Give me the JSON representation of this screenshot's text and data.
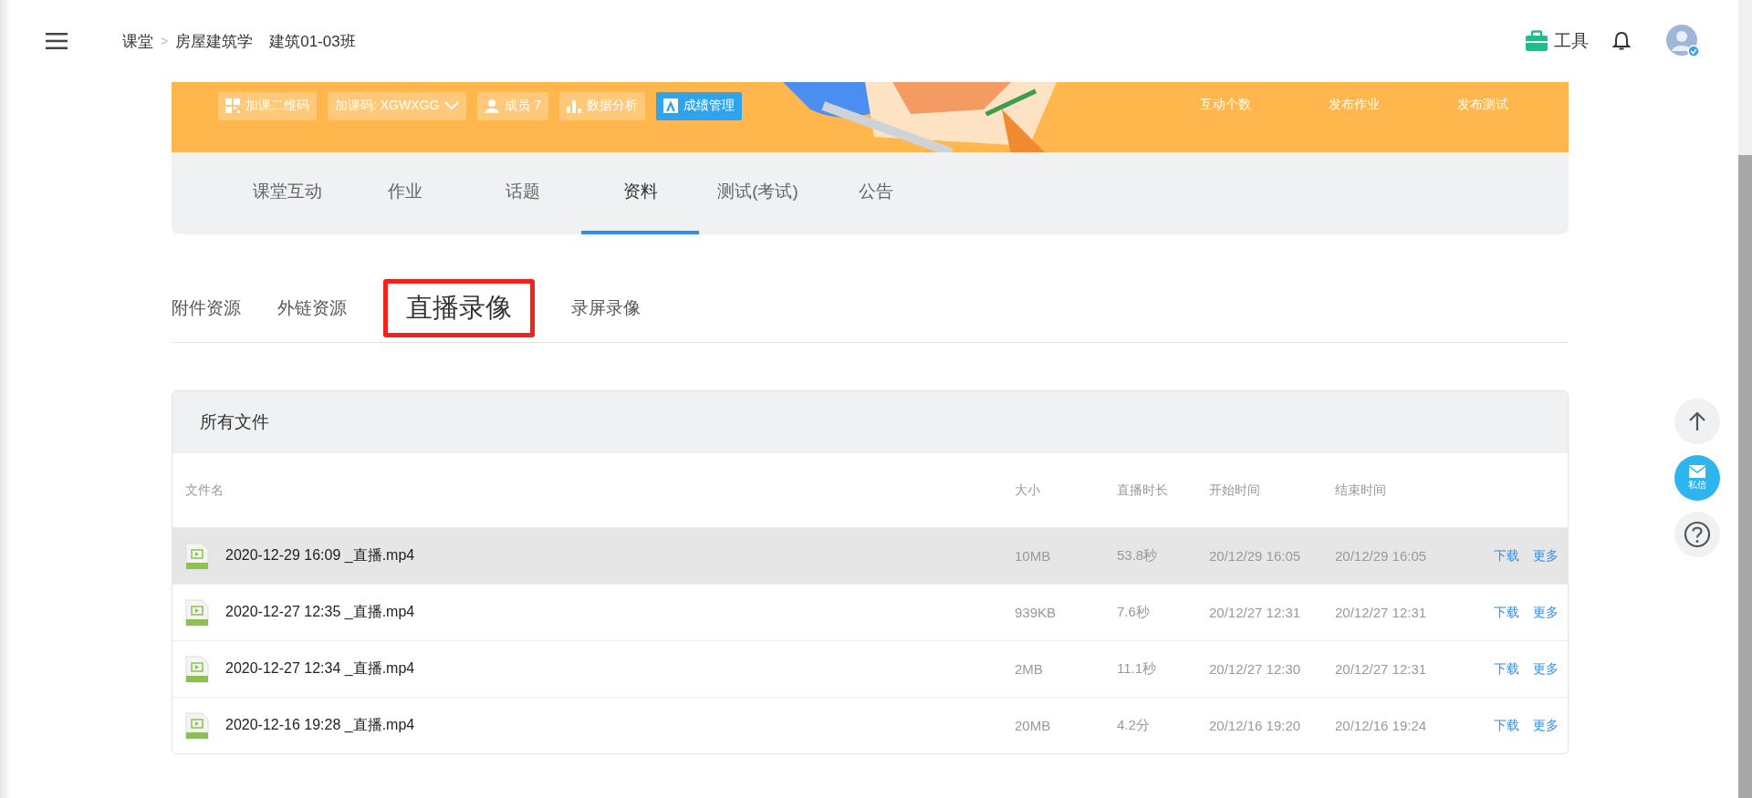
{
  "breadcrumb": {
    "items": [
      "课堂",
      "房屋建筑学",
      "建筑01-03班"
    ],
    "separator": ">"
  },
  "toolbar": {
    "tools_label": "工具"
  },
  "banner": {
    "buttons": [
      {
        "kind": "qr",
        "label": "加课二维码"
      },
      {
        "kind": "code",
        "label": "加课码: XGWXGG"
      },
      {
        "kind": "members",
        "label": "成员 7"
      },
      {
        "kind": "stats",
        "label": "数据分析"
      },
      {
        "kind": "grades",
        "label": "成绩管理"
      }
    ],
    "links": [
      "互动个数",
      "发布作业",
      "发布测试"
    ]
  },
  "nav_tabs": [
    {
      "label": "课堂互动",
      "selected": false
    },
    {
      "label": "作业",
      "selected": false
    },
    {
      "label": "话题",
      "selected": false
    },
    {
      "label": "资料",
      "selected": true
    },
    {
      "label": "测试(考试)",
      "selected": false
    },
    {
      "label": "公告",
      "selected": false
    }
  ],
  "sub_tabs": [
    {
      "label": "附件资源",
      "selected": false
    },
    {
      "label": "外链资源",
      "selected": false
    },
    {
      "label": "直播录像",
      "selected": true
    },
    {
      "label": "录屏录像",
      "selected": false
    }
  ],
  "file_list": {
    "title": "所有文件",
    "columns": [
      "文件名",
      "大小",
      "直播时长",
      "开始时间",
      "结束时间"
    ],
    "rows": [
      {
        "name": "2020-12-29 16:09 _直播.mp4",
        "size": "10MB",
        "duration": "53.8秒",
        "start": "20/12/29 16:05",
        "end": "20/12/29 16:05",
        "actions": [
          "下载",
          "更多"
        ],
        "selected": true
      },
      {
        "name": "2020-12-27 12:35 _直播.mp4",
        "size": "939KB",
        "duration": "7.6秒",
        "start": "20/12/27 12:31",
        "end": "20/12/27 12:31",
        "actions": [
          "下载",
          "更多"
        ],
        "selected": false
      },
      {
        "name": "2020-12-27 12:34 _直播.mp4",
        "size": "2MB",
        "duration": "11.1秒",
        "start": "20/12/27 12:30",
        "end": "20/12/27 12:31",
        "actions": [
          "下载",
          "更多"
        ],
        "selected": false
      },
      {
        "name": "2020-12-16 19:28 _直播.mp4",
        "size": "20MB",
        "duration": "4.2分",
        "start": "20/12/16 19:20",
        "end": "20/12/16 19:24",
        "actions": [
          "下载",
          "更多"
        ],
        "selected": false
      }
    ]
  },
  "side_buttons": {
    "message_label": "私信"
  }
}
